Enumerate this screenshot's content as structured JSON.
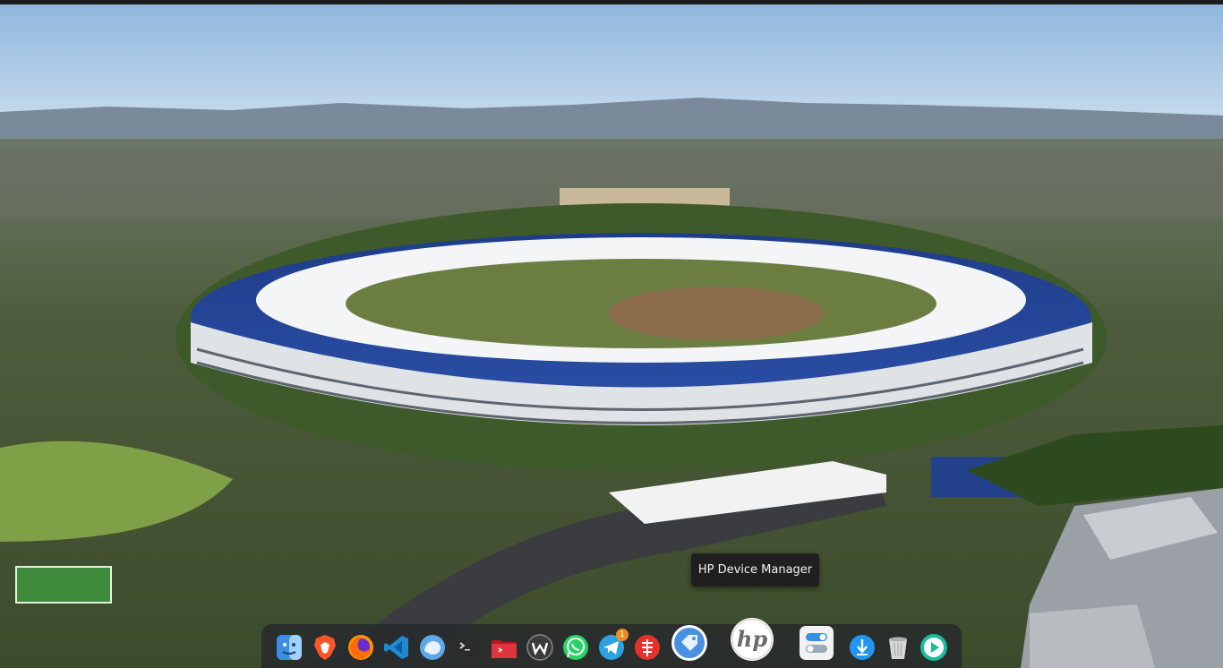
{
  "tooltip": {
    "text": "HP Device Manager"
  },
  "dock": {
    "items": [
      {
        "name": "finder-icon",
        "accent": "#3a8ee6"
      },
      {
        "name": "brave-browser-icon",
        "accent": "#fb542b"
      },
      {
        "name": "firefox-icon",
        "accent": "#ff9500"
      },
      {
        "name": "vscode-icon",
        "accent": "#1f8ad2"
      },
      {
        "name": "messenger-icon",
        "accent": "#5fa8e8"
      },
      {
        "name": "terminal-icon",
        "accent": "#2b2b2b"
      },
      {
        "name": "folder-red-icon",
        "accent": "#d9282f"
      },
      {
        "name": "winstep-icon",
        "accent": "#3b3b3b"
      },
      {
        "name": "whatsapp-icon",
        "accent": "#25d366"
      },
      {
        "name": "telegram-icon",
        "accent": "#2aa3e0",
        "badge": "1"
      },
      {
        "name": "anydesk-icon",
        "accent": "#e4312b"
      },
      {
        "name": "tag-icon",
        "accent": "#4a90e2"
      },
      {
        "name": "hp-device-manager-icon",
        "accent": "#ffffff"
      },
      {
        "name": "settings-toggle-icon",
        "accent": "#3a8ee6"
      },
      {
        "name": "download-icon",
        "accent": "#2196f3"
      },
      {
        "name": "trash-icon",
        "accent": "#cfcfcf"
      },
      {
        "name": "media-player-icon",
        "accent": "#1abc9c"
      }
    ]
  },
  "hp_logo_text": "hp"
}
